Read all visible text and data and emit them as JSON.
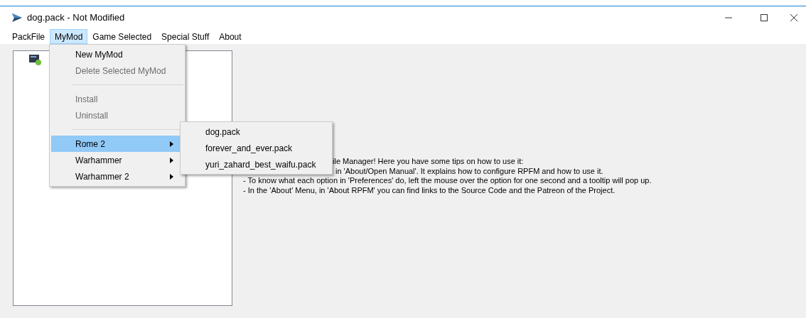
{
  "window": {
    "title": "dog.pack - Not Modified"
  },
  "menu_bar": [
    {
      "label": "PackFile",
      "selected": false
    },
    {
      "label": "MyMod",
      "selected": true
    },
    {
      "label": "Game Selected",
      "selected": false
    },
    {
      "label": "Special Stuff",
      "selected": false
    },
    {
      "label": "About",
      "selected": false
    }
  ],
  "menu": [
    {
      "kind": "item",
      "label": "New MyMod",
      "disabled": false,
      "selected": false,
      "submenu": false
    },
    {
      "kind": "item",
      "label": "Delete Selected MyMod",
      "disabled": true,
      "selected": false,
      "submenu": false
    },
    {
      "kind": "separator"
    },
    {
      "kind": "item",
      "label": "Install",
      "disabled": true,
      "selected": false,
      "submenu": false
    },
    {
      "kind": "item",
      "label": "Uninstall",
      "disabled": true,
      "selected": false,
      "submenu": false
    },
    {
      "kind": "separator"
    },
    {
      "kind": "item",
      "label": "Rome 2",
      "disabled": false,
      "selected": true,
      "submenu": true
    },
    {
      "kind": "item",
      "label": "Warhammer",
      "disabled": false,
      "selected": false,
      "submenu": true
    },
    {
      "kind": "item",
      "label": "Warhammer 2",
      "disabled": false,
      "selected": false,
      "submenu": true
    }
  ],
  "submenu": [
    "dog.pack",
    "forever_and_ever.pack",
    "yuri_zahard_best_waifu.pack"
  ],
  "welcome_lines": [
    "ile Manager! Here you have some tips on how to use it:",
    "in 'About/Open Manual'. It explains how to configure RPFM and how to use it.",
    "- To know what each option in 'Preferences' do, left the mouse over the option for one second and a tooltip will pop up.",
    "- In the 'About' Menu, in 'About RPFM' you can find links to the Source Code and the Patreon of the Project."
  ]
}
